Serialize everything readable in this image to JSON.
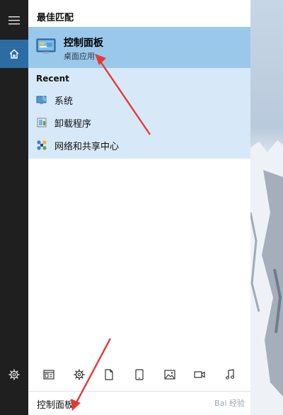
{
  "rail": {
    "menu_icon": "hamburger-icon",
    "home_icon": "home-icon",
    "settings_icon": "gear-icon",
    "home_bg": "#2b6ca3"
  },
  "best_match": {
    "header": "最佳匹配",
    "title": "控制面板",
    "subtitle": "桌面应用",
    "icon": "control-panel-icon",
    "highlight_color": "#99c8ea"
  },
  "recent": {
    "header": "Recent",
    "background": "#d7e9f8",
    "items": [
      {
        "label": "系统",
        "icon": "system-icon"
      },
      {
        "label": "卸载程序",
        "icon": "uninstall-program-icon"
      },
      {
        "label": "网络和共享中心",
        "icon": "network-sharing-icon"
      }
    ]
  },
  "filters": [
    {
      "name": "apps-filter",
      "icon": "apps-icon"
    },
    {
      "name": "settings-filter",
      "icon": "gear-icon"
    },
    {
      "name": "documents-filter",
      "icon": "document-icon"
    },
    {
      "name": "tablet-filter",
      "icon": "tablet-icon"
    },
    {
      "name": "photos-filter",
      "icon": "photo-icon"
    },
    {
      "name": "videos-filter",
      "icon": "video-icon"
    },
    {
      "name": "music-filter",
      "icon": "music-icon"
    }
  ],
  "search": {
    "value": "控制面板",
    "watermark": "Bai 经验"
  },
  "annotation_color": "#e53935"
}
